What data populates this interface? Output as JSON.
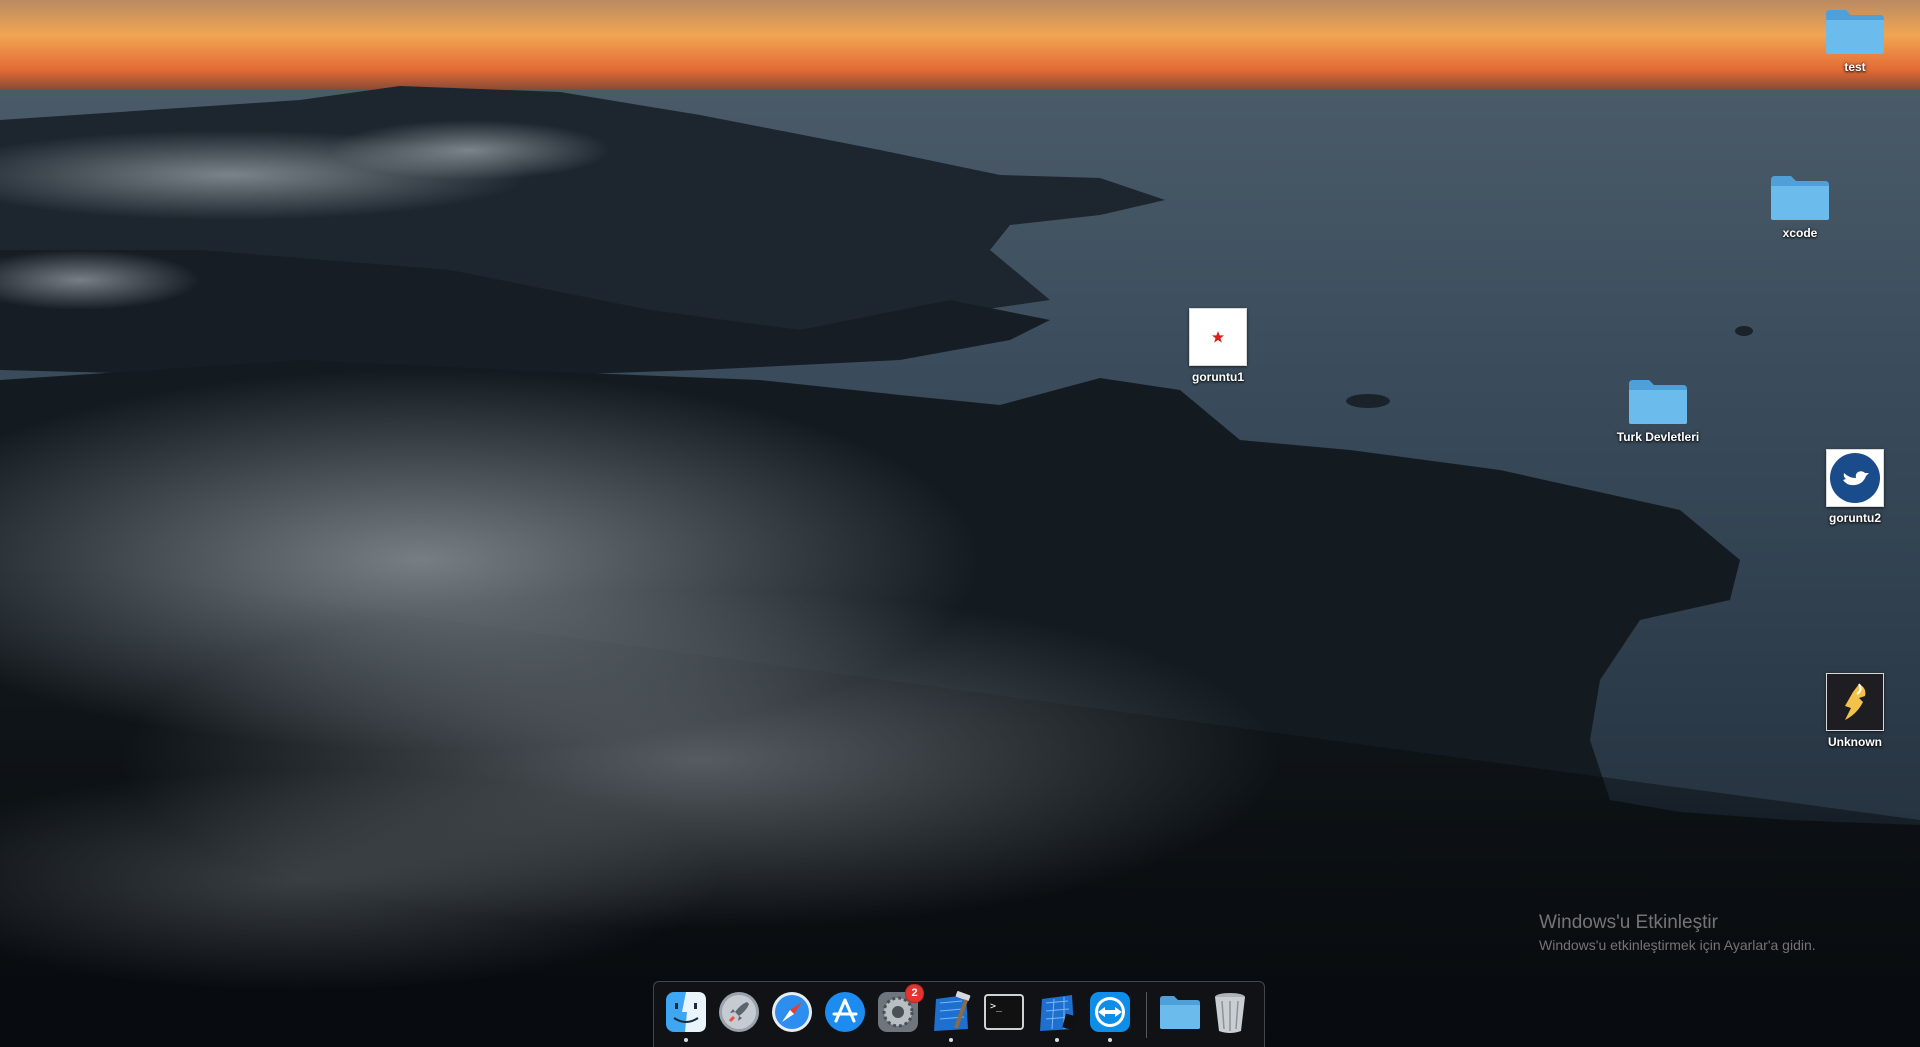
{
  "desktop": {
    "icons": [
      {
        "label": "test",
        "kind": "folder",
        "icon": "folder-icon"
      },
      {
        "label": "xcode",
        "kind": "folder",
        "icon": "folder-icon"
      },
      {
        "label": "goruntu1",
        "kind": "image",
        "icon": "image-thumbnail-icon"
      },
      {
        "label": "Turk Devletleri",
        "kind": "folder",
        "icon": "folder-icon"
      },
      {
        "label": "goruntu2",
        "kind": "image",
        "icon": "bird-logo-icon"
      },
      {
        "label": "Unknown",
        "kind": "image",
        "icon": "lightning-logo-icon"
      }
    ]
  },
  "watermark": {
    "title": "Windows'u Etkinleştir",
    "subtitle": "Windows'u etkinleştirmek için Ayarlar'a gidin."
  },
  "dock": {
    "items": [
      {
        "app": "Finder",
        "icon": "finder-icon",
        "running": true
      },
      {
        "app": "Launchpad",
        "icon": "rocket-icon",
        "running": false
      },
      {
        "app": "Safari",
        "icon": "compass-icon",
        "running": false
      },
      {
        "app": "App Store",
        "icon": "app-store-icon",
        "running": false
      },
      {
        "app": "System Preferences",
        "icon": "gear-icon",
        "running": false,
        "badge": "2"
      },
      {
        "app": "Xcode",
        "icon": "hammer-blueprint-icon",
        "running": true
      },
      {
        "app": "Terminal",
        "icon": "terminal-icon",
        "running": false
      },
      {
        "app": "Instruments",
        "icon": "blueprint-icon",
        "running": true
      },
      {
        "app": "TeamViewer",
        "icon": "teamviewer-icon",
        "running": true
      },
      {
        "app": "Downloads",
        "icon": "folder-icon",
        "running": false
      },
      {
        "app": "Trash",
        "icon": "trash-icon",
        "running": false
      }
    ]
  },
  "colors": {
    "folder": "#62b3e8",
    "sky_orange": "#f0a050",
    "sea": "#2a3a4a",
    "badge": "#e5342f"
  }
}
